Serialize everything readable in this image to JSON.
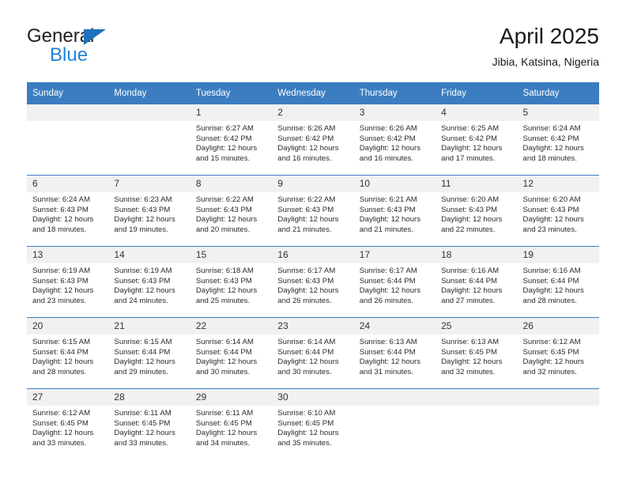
{
  "brand": {
    "name_top": "General",
    "name_bottom": "Blue",
    "triangle_color": "#1f72bd",
    "blue_color": "#1f83d6"
  },
  "header": {
    "title": "April 2025",
    "subtitle": "Jibia, Katsina, Nigeria"
  },
  "theme": {
    "header_bg": "#3b7dc0",
    "daynum_bg": "#f1f1f1",
    "text": "#2b2b2b"
  },
  "weekdays": [
    "Sunday",
    "Monday",
    "Tuesday",
    "Wednesday",
    "Thursday",
    "Friday",
    "Saturday"
  ],
  "weeks": [
    [
      {
        "day": "",
        "sunrise": "",
        "sunset": "",
        "daylight1": "",
        "daylight2": "",
        "blank": true
      },
      {
        "day": "",
        "sunrise": "",
        "sunset": "",
        "daylight1": "",
        "daylight2": "",
        "blank": true
      },
      {
        "day": "1",
        "sunrise": "Sunrise: 6:27 AM",
        "sunset": "Sunset: 6:42 PM",
        "daylight1": "Daylight: 12 hours",
        "daylight2": "and 15 minutes."
      },
      {
        "day": "2",
        "sunrise": "Sunrise: 6:26 AM",
        "sunset": "Sunset: 6:42 PM",
        "daylight1": "Daylight: 12 hours",
        "daylight2": "and 16 minutes."
      },
      {
        "day": "3",
        "sunrise": "Sunrise: 6:26 AM",
        "sunset": "Sunset: 6:42 PM",
        "daylight1": "Daylight: 12 hours",
        "daylight2": "and 16 minutes."
      },
      {
        "day": "4",
        "sunrise": "Sunrise: 6:25 AM",
        "sunset": "Sunset: 6:42 PM",
        "daylight1": "Daylight: 12 hours",
        "daylight2": "and 17 minutes."
      },
      {
        "day": "5",
        "sunrise": "Sunrise: 6:24 AM",
        "sunset": "Sunset: 6:42 PM",
        "daylight1": "Daylight: 12 hours",
        "daylight2": "and 18 minutes."
      }
    ],
    [
      {
        "day": "6",
        "sunrise": "Sunrise: 6:24 AM",
        "sunset": "Sunset: 6:43 PM",
        "daylight1": "Daylight: 12 hours",
        "daylight2": "and 18 minutes."
      },
      {
        "day": "7",
        "sunrise": "Sunrise: 6:23 AM",
        "sunset": "Sunset: 6:43 PM",
        "daylight1": "Daylight: 12 hours",
        "daylight2": "and 19 minutes."
      },
      {
        "day": "8",
        "sunrise": "Sunrise: 6:22 AM",
        "sunset": "Sunset: 6:43 PM",
        "daylight1": "Daylight: 12 hours",
        "daylight2": "and 20 minutes."
      },
      {
        "day": "9",
        "sunrise": "Sunrise: 6:22 AM",
        "sunset": "Sunset: 6:43 PM",
        "daylight1": "Daylight: 12 hours",
        "daylight2": "and 21 minutes."
      },
      {
        "day": "10",
        "sunrise": "Sunrise: 6:21 AM",
        "sunset": "Sunset: 6:43 PM",
        "daylight1": "Daylight: 12 hours",
        "daylight2": "and 21 minutes."
      },
      {
        "day": "11",
        "sunrise": "Sunrise: 6:20 AM",
        "sunset": "Sunset: 6:43 PM",
        "daylight1": "Daylight: 12 hours",
        "daylight2": "and 22 minutes."
      },
      {
        "day": "12",
        "sunrise": "Sunrise: 6:20 AM",
        "sunset": "Sunset: 6:43 PM",
        "daylight1": "Daylight: 12 hours",
        "daylight2": "and 23 minutes."
      }
    ],
    [
      {
        "day": "13",
        "sunrise": "Sunrise: 6:19 AM",
        "sunset": "Sunset: 6:43 PM",
        "daylight1": "Daylight: 12 hours",
        "daylight2": "and 23 minutes."
      },
      {
        "day": "14",
        "sunrise": "Sunrise: 6:19 AM",
        "sunset": "Sunset: 6:43 PM",
        "daylight1": "Daylight: 12 hours",
        "daylight2": "and 24 minutes."
      },
      {
        "day": "15",
        "sunrise": "Sunrise: 6:18 AM",
        "sunset": "Sunset: 6:43 PM",
        "daylight1": "Daylight: 12 hours",
        "daylight2": "and 25 minutes."
      },
      {
        "day": "16",
        "sunrise": "Sunrise: 6:17 AM",
        "sunset": "Sunset: 6:43 PM",
        "daylight1": "Daylight: 12 hours",
        "daylight2": "and 26 minutes."
      },
      {
        "day": "17",
        "sunrise": "Sunrise: 6:17 AM",
        "sunset": "Sunset: 6:44 PM",
        "daylight1": "Daylight: 12 hours",
        "daylight2": "and 26 minutes."
      },
      {
        "day": "18",
        "sunrise": "Sunrise: 6:16 AM",
        "sunset": "Sunset: 6:44 PM",
        "daylight1": "Daylight: 12 hours",
        "daylight2": "and 27 minutes."
      },
      {
        "day": "19",
        "sunrise": "Sunrise: 6:16 AM",
        "sunset": "Sunset: 6:44 PM",
        "daylight1": "Daylight: 12 hours",
        "daylight2": "and 28 minutes."
      }
    ],
    [
      {
        "day": "20",
        "sunrise": "Sunrise: 6:15 AM",
        "sunset": "Sunset: 6:44 PM",
        "daylight1": "Daylight: 12 hours",
        "daylight2": "and 28 minutes."
      },
      {
        "day": "21",
        "sunrise": "Sunrise: 6:15 AM",
        "sunset": "Sunset: 6:44 PM",
        "daylight1": "Daylight: 12 hours",
        "daylight2": "and 29 minutes."
      },
      {
        "day": "22",
        "sunrise": "Sunrise: 6:14 AM",
        "sunset": "Sunset: 6:44 PM",
        "daylight1": "Daylight: 12 hours",
        "daylight2": "and 30 minutes."
      },
      {
        "day": "23",
        "sunrise": "Sunrise: 6:14 AM",
        "sunset": "Sunset: 6:44 PM",
        "daylight1": "Daylight: 12 hours",
        "daylight2": "and 30 minutes."
      },
      {
        "day": "24",
        "sunrise": "Sunrise: 6:13 AM",
        "sunset": "Sunset: 6:44 PM",
        "daylight1": "Daylight: 12 hours",
        "daylight2": "and 31 minutes."
      },
      {
        "day": "25",
        "sunrise": "Sunrise: 6:13 AM",
        "sunset": "Sunset: 6:45 PM",
        "daylight1": "Daylight: 12 hours",
        "daylight2": "and 32 minutes."
      },
      {
        "day": "26",
        "sunrise": "Sunrise: 6:12 AM",
        "sunset": "Sunset: 6:45 PM",
        "daylight1": "Daylight: 12 hours",
        "daylight2": "and 32 minutes."
      }
    ],
    [
      {
        "day": "27",
        "sunrise": "Sunrise: 6:12 AM",
        "sunset": "Sunset: 6:45 PM",
        "daylight1": "Daylight: 12 hours",
        "daylight2": "and 33 minutes."
      },
      {
        "day": "28",
        "sunrise": "Sunrise: 6:11 AM",
        "sunset": "Sunset: 6:45 PM",
        "daylight1": "Daylight: 12 hours",
        "daylight2": "and 33 minutes."
      },
      {
        "day": "29",
        "sunrise": "Sunrise: 6:11 AM",
        "sunset": "Sunset: 6:45 PM",
        "daylight1": "Daylight: 12 hours",
        "daylight2": "and 34 minutes."
      },
      {
        "day": "30",
        "sunrise": "Sunrise: 6:10 AM",
        "sunset": "Sunset: 6:45 PM",
        "daylight1": "Daylight: 12 hours",
        "daylight2": "and 35 minutes."
      },
      {
        "day": "",
        "sunrise": "",
        "sunset": "",
        "daylight1": "",
        "daylight2": "",
        "blank": true
      },
      {
        "day": "",
        "sunrise": "",
        "sunset": "",
        "daylight1": "",
        "daylight2": "",
        "blank": true
      },
      {
        "day": "",
        "sunrise": "",
        "sunset": "",
        "daylight1": "",
        "daylight2": "",
        "blank": true
      }
    ]
  ]
}
